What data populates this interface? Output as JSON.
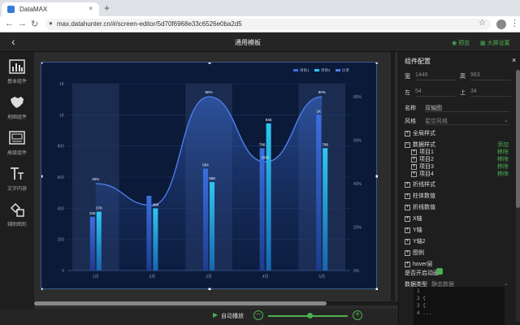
{
  "browser": {
    "tab_title": "DataMAX",
    "tab_close": "×",
    "new_tab": "+",
    "url": "max.datahunter.cn/#/screen-editor/5d70f6968e33c6526e0ba2d5",
    "back_glyph": "←",
    "forward_glyph": "→",
    "reload_glyph": "↻",
    "lock_glyph": "🔒",
    "star_glyph": "☆",
    "menu_glyph": "⋮"
  },
  "header": {
    "back_glyph": "‹",
    "title": "通用模板",
    "preview_label": "预览",
    "screen_settings_label": "大屏设置"
  },
  "sidebar": {
    "items": [
      {
        "label": "基本组件",
        "icon": "bar-chart-icon",
        "glyph": "📊"
      },
      {
        "label": "地图组件",
        "icon": "map-icon",
        "glyph": "🗺"
      },
      {
        "label": "高级组件",
        "icon": "advanced-component-icon",
        "glyph": "▣"
      },
      {
        "label": "文字内容",
        "icon": "text-icon",
        "glyph": "Tт"
      },
      {
        "label": "辅助图形",
        "icon": "shapes-icon",
        "glyph": "◇"
      }
    ]
  },
  "bottom": {
    "autoplay_label": "自动播放",
    "zoom_minus": "−",
    "zoom_plus": "+",
    "zoom_level": 0.52
  },
  "panel": {
    "title": "组件配置",
    "close_glyph": "×",
    "width_label": "宽",
    "width_value": "1446",
    "height_label": "高",
    "height_value": "963",
    "left_label": "左",
    "left_value": "54",
    "top_label": "上",
    "top_value": "34",
    "name_label": "名称",
    "name_value": "双轴图",
    "style_label": "风格",
    "style_value": "星空风格",
    "sections": {
      "global_style": "全局样式",
      "data_style": "数据样式",
      "add_label": "添加",
      "items": [
        "项目1",
        "项目2",
        "项目3",
        "项目4"
      ],
      "remove_label": "移除",
      "line_style": "折线样式",
      "bar_value": "柱体数值",
      "line_value": "折线数值",
      "x_axis": "X轴",
      "y_axis": "Y轴",
      "y_axis2": "Y轴2",
      "legend": "图例",
      "hover": "hover层",
      "autoplay_toggle": "是否开启动画",
      "data_type_label": "数据类型",
      "data_type_value": "静态数据"
    },
    "code_lines": [
      "1",
      "2  {",
      "3    {",
      "4      ..."
    ]
  },
  "chart_data": {
    "type": "bar",
    "categories": [
      "1月",
      "2月",
      "3月",
      "4月",
      "5月"
    ],
    "series": [
      {
        "name": "项目1",
        "values": [
          345,
          480,
          654,
          786,
          1000
        ],
        "color": "#3b6fe0"
      },
      {
        "name": "项目2",
        "values": [
          378,
          399,
          568,
          945,
          786
        ],
        "color": "#2ec7f0"
      },
      {
        "name": "比率",
        "type": "line",
        "values": [
          40,
          30,
          80,
          50,
          80
        ],
        "color": "#4b7de8"
      }
    ],
    "value_labels": {
      "项目1": [
        "345",
        "",
        "654",
        "786",
        "1K"
      ],
      "项目2": [
        "378",
        "399",
        "568",
        "945",
        "786"
      ],
      "比率": [
        "40%",
        "",
        "80%",
        "50%",
        "80%"
      ]
    },
    "y_ticks": [
      "0",
      "200",
      "400",
      "600",
      "800",
      "1K",
      "1K"
    ],
    "y_ticks_values": [
      0,
      200,
      400,
      600,
      800,
      1000,
      1200
    ],
    "y2_ticks": [
      "0%",
      "20%",
      "40%",
      "60%",
      "80%"
    ],
    "ylim": [
      0,
      1200
    ],
    "y2lim": [
      0,
      80
    ],
    "legend_position": "top-right",
    "legend": [
      "项目1",
      "项目2",
      "比率"
    ],
    "highlight_band_categories": [
      "1月",
      "3月",
      "5月"
    ]
  },
  "colors": {
    "accent": "#4caf50",
    "chart_bg": "#0b1a39",
    "bar1": "#3b6fe0",
    "bar2": "#2ec7f0"
  }
}
